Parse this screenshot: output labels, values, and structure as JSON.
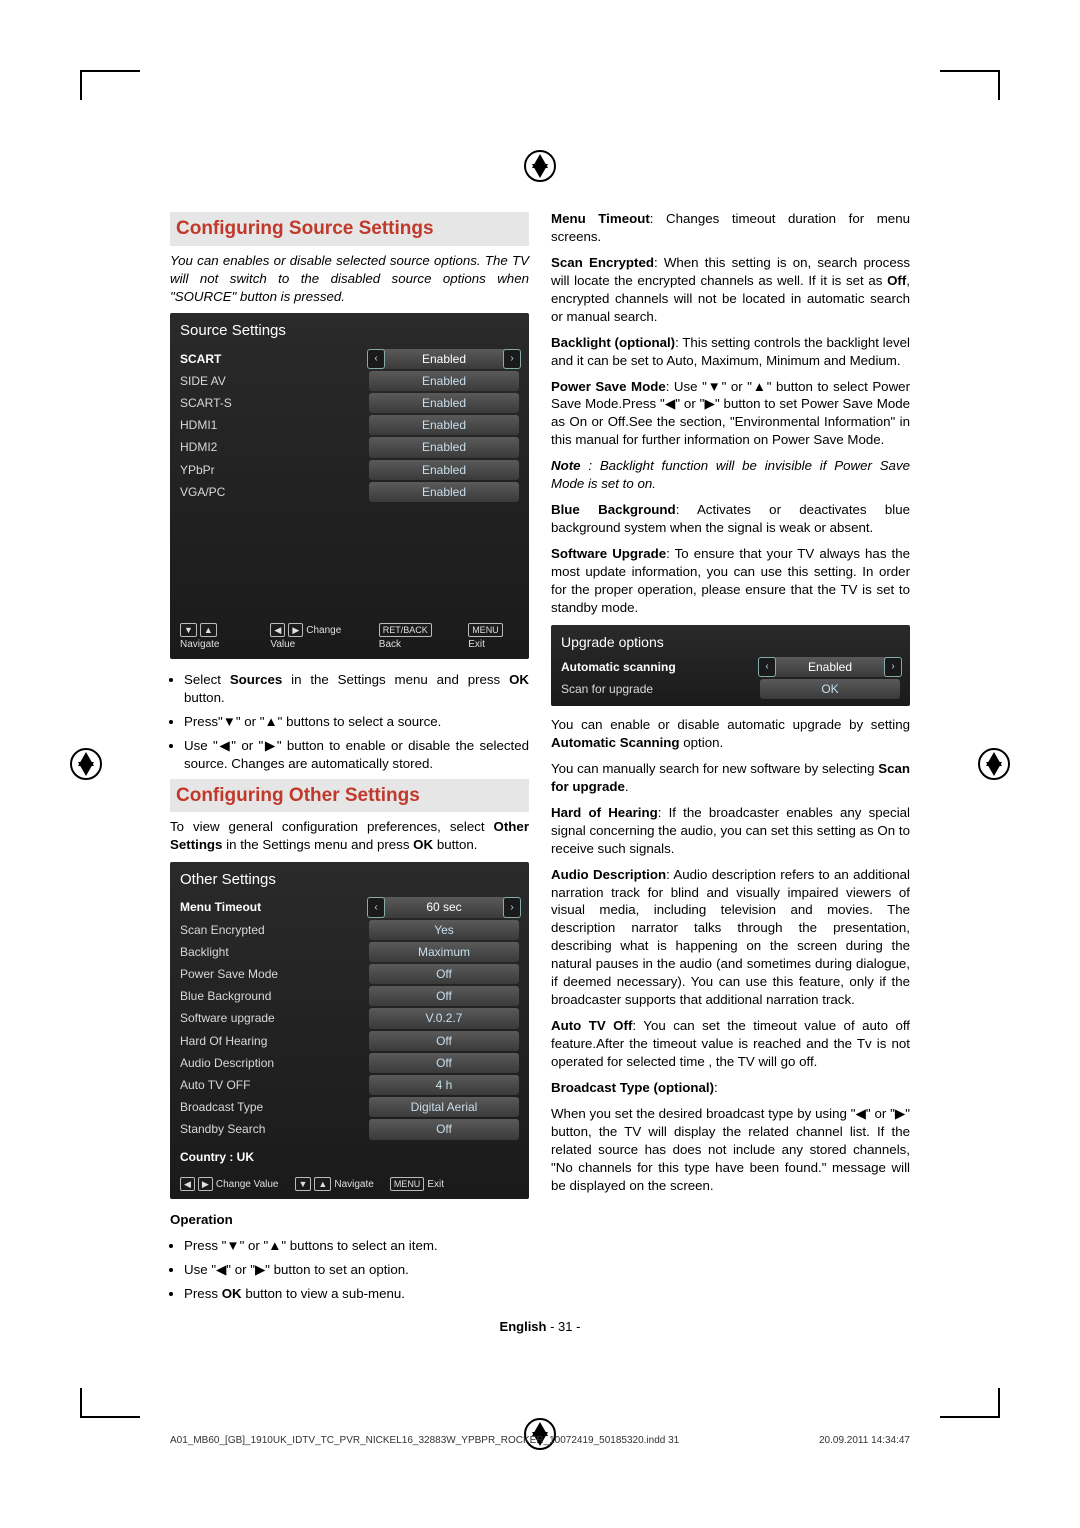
{
  "headings": {
    "source": "Configuring Source Settings",
    "other": "Configuring Other Settings",
    "operation": "Operation"
  },
  "intro": {
    "source_italic": "You can enables or disable selected source options. The TV will not switch to the disabled source options when \"SOURCE\" button is pressed.",
    "other": "To view general configuration preferences, select Other Settings in the Settings menu and press OK button."
  },
  "source_osd": {
    "title": "Source Settings",
    "rows": [
      {
        "label": "SCART",
        "value": "Enabled",
        "sel": true
      },
      {
        "label": "SIDE AV",
        "value": "Enabled"
      },
      {
        "label": "SCART-S",
        "value": "Enabled"
      },
      {
        "label": "HDMI1",
        "value": "Enabled"
      },
      {
        "label": "HDMI2",
        "value": "Enabled"
      },
      {
        "label": "YPbPr",
        "value": "Enabled"
      },
      {
        "label": "VGA/PC",
        "value": "Enabled"
      }
    ],
    "foot": {
      "nav": "Navigate",
      "change": "Change Value",
      "back": "Back",
      "exit": "Exit",
      "back_key": "RET/BACK",
      "exit_key": "MENU"
    }
  },
  "source_bullets": {
    "b1a": "Select ",
    "b1b": "Sources",
    "b1c": " in the Settings menu and press ",
    "b1d": "OK",
    "b1e": " button.",
    "b2": "Press\"▼\" or \"▲\" buttons to select a source.",
    "b3": "Use \"◀\" or \"▶\" button to enable or disable the selected source. Changes are automatically stored."
  },
  "other_osd": {
    "title": "Other Settings",
    "rows": [
      {
        "label": "Menu Timeout",
        "value": "60 sec",
        "sel": true
      },
      {
        "label": "Scan Encrypted",
        "value": "Yes"
      },
      {
        "label": "Backlight",
        "value": "Maximum"
      },
      {
        "label": "Power Save Mode",
        "value": "Off"
      },
      {
        "label": "Blue Background",
        "value": "Off"
      },
      {
        "label": "Software upgrade",
        "value": "V.0.2.7"
      },
      {
        "label": "Hard Of Hearing",
        "value": "Off"
      },
      {
        "label": "Audio Description",
        "value": "Off"
      },
      {
        "label": "Auto TV OFF",
        "value": "4 h"
      },
      {
        "label": "Broadcast Type",
        "value": "Digital Aerial"
      },
      {
        "label": "Standby Search",
        "value": "Off"
      }
    ],
    "country": "Country : UK",
    "foot": {
      "change": "Change Value",
      "nav": "Navigate",
      "exit": "Exit",
      "exit_key": "MENU"
    }
  },
  "op_bullets": {
    "b1": "Press \"▼\" or \"▲\" buttons to select an item.",
    "b2": "Use \"◀\" or \"▶\" button to set an option.",
    "b3a": "Press ",
    "b3b": "OK",
    "b3c": " button to view a sub-menu."
  },
  "right": {
    "menu_timeout_l": "Menu Timeout",
    "menu_timeout_t": ": Changes timeout duration for menu screens.",
    "scan_enc_l": "Scan Encrypted",
    "scan_enc_t1": ": When this setting is on, search process will locate the encrypted channels as well. If it is set as ",
    "scan_enc_off": "Off",
    "scan_enc_t2": ", encrypted channels will not be located in automatic search or manual search.",
    "backlight_l": "Backlight (optional)",
    "backlight_t": ": This setting controls the backlight level and it can be set to Auto, Maximum, Minimum and Medium.",
    "psm_l": "Power Save Mode",
    "psm_t": ": Use \"▼\" or \"▲\" button to select Power Save Mode.Press \"◀\" or \"▶\" button to set Power Save Mode as On or Off.See the section, \"Environmental Information\" in this manual for further information on Power Save Mode.",
    "note_l": "Note",
    "note_t": " : Backlight function will be invisible if Power Save Mode is set to on.",
    "blue_l": "Blue Background",
    "blue_t": ": Activates or deactivates blue background system when the signal is weak or absent.",
    "sw_l": "Software Upgrade",
    "sw_t": ": To ensure that your TV always has the most update information, you can use this setting. In order for the proper operation, please ensure that the TV is set to standby mode.",
    "auto_en_t1": "You can enable or disable automatic upgrade by setting ",
    "auto_en_b": "Automatic Scanning",
    "auto_en_t2": " option.",
    "manual_t1": "You can manually search for new software by selecting ",
    "manual_b": "Scan for upgrade",
    "manual_t2": ".",
    "hoh_l": "Hard of Hearing",
    "hoh_t": ": If the broadcaster enables any special signal concerning the audio, you can set this setting as On to receive such signals.",
    "ad_l": "Audio Description",
    "ad_t": ": Audio description refers to an additional narration track for blind and visually impaired viewers of visual media, including television and movies. The description narrator talks through the presentation, describing what is happening on the screen during the natural pauses in the audio (and sometimes during dialogue, if deemed necessary). You can use this feature, only if the broadcaster supports that additional narration track.",
    "atv_l": "Auto TV Off",
    "atv_t": ": You can set the timeout value of auto off feature.After the timeout value is reached and the Tv is not operated for selected time , the TV will go off.",
    "bt_l": "Broadcast Type (optional)",
    "bt_colon": ":",
    "bt_t": "When you set the desired broadcast type by using \"◀\" or \"▶\" button, the TV will display the related channel list. If the related source has does not include any stored channels, \"No channels for this type have been found.\" message will be displayed on the screen."
  },
  "upgrade_osd": {
    "title": "Upgrade options",
    "row1_label": "Automatic scanning",
    "row1_value": "Enabled",
    "row2_label": "Scan for upgrade",
    "row2_value": "OK"
  },
  "footer": {
    "lang": "English",
    "page": "- 31 -",
    "indd": "A01_MB60_[GB]_1910UK_IDTV_TC_PVR_NICKEL16_32883W_YPBPR_ROCKER_10072419_50185320.indd   31",
    "date": "20.09.2011   14:34:47"
  }
}
